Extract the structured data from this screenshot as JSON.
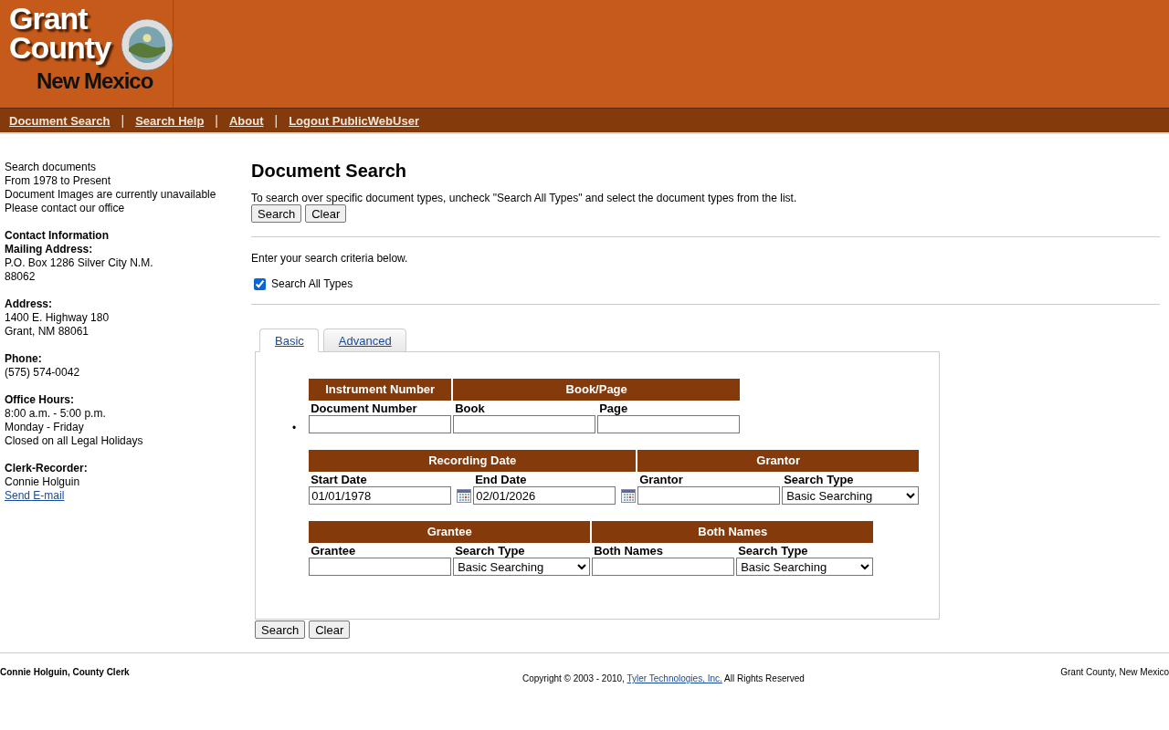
{
  "logo": {
    "lines": [
      "Grant",
      "County",
      "New Mexico"
    ]
  },
  "nav": [
    "Document Search",
    "Search Help",
    "About",
    "Logout PublicWebUser"
  ],
  "nav_separator": "|",
  "sidebar": [
    {
      "lines": [
        {
          "kind": "text",
          "text": "Search documents"
        },
        {
          "kind": "text",
          "text": "From 1978 to Present"
        },
        {
          "kind": "text",
          "text": "Document Images are currently unavailable"
        },
        {
          "kind": "text",
          "text": "Please contact our office"
        }
      ]
    },
    {
      "lines": [
        {
          "kind": "heading",
          "text": "Contact Information"
        },
        {
          "kind": "heading",
          "text": "Mailing Address:"
        },
        {
          "kind": "text",
          "text": "P.O. Box 1286 Silver City N.M."
        },
        {
          "kind": "text",
          "text": "88062"
        }
      ]
    },
    {
      "lines": [
        {
          "kind": "heading",
          "text": "Address:"
        },
        {
          "kind": "text",
          "text": "1400 E. Highway 180"
        },
        {
          "kind": "text",
          "text": "Grant, NM 88061"
        }
      ]
    },
    {
      "lines": [
        {
          "kind": "heading",
          "text": "Phone:"
        },
        {
          "kind": "text",
          "text": "(575) 574-0042"
        }
      ]
    },
    {
      "lines": [
        {
          "kind": "heading",
          "text": "Office Hours:"
        },
        {
          "kind": "text",
          "text": "8:00 a.m. - 5:00 p.m."
        },
        {
          "kind": "text",
          "text": "Monday - Friday"
        },
        {
          "kind": "text",
          "text": "Closed on all Legal Holidays"
        }
      ]
    },
    {
      "lines": [
        {
          "kind": "heading",
          "text": "Clerk-Recorder:"
        },
        {
          "kind": "text",
          "text": "Connie Holguin"
        },
        {
          "kind": "link",
          "text": "Send E-mail"
        }
      ]
    }
  ],
  "title": "Document Search",
  "instructions": "To search over specific document types, uncheck \"Search All Types\" and select the document types from the list.",
  "top_buttons": [
    "Search",
    "Clear"
  ],
  "criteria_text": "Enter your search criteria below.",
  "search_all_types": {
    "label": "Search All Types",
    "checked": true
  },
  "tabs": [
    {
      "label": "Basic",
      "selected": true
    },
    {
      "label": "Advanced",
      "selected": false
    }
  ],
  "bullet": "•",
  "sections": [
    {
      "groups": [
        {
          "header": "Instrument Number",
          "fields": [
            {
              "kind": "text",
              "label": "Document Number"
            }
          ]
        },
        {
          "header": "Book/Page",
          "fields": [
            {
              "kind": "text",
              "label": "Book"
            },
            {
              "kind": "text",
              "label": "Page"
            }
          ]
        }
      ]
    },
    {
      "groups": [
        {
          "header": "Recording Date",
          "fields": [
            {
              "kind": "date",
              "label": "Start Date",
              "value": "01/01/1978"
            },
            {
              "kind": "date",
              "label": "End Date",
              "value": "02/01/2026"
            }
          ]
        },
        {
          "header": "Grantor",
          "fields": [
            {
              "kind": "text",
              "label": "Grantor"
            },
            {
              "kind": "select",
              "label": "Search Type",
              "value": "Basic Searching"
            }
          ]
        }
      ]
    },
    {
      "groups": [
        {
          "header": "Grantee",
          "fields": [
            {
              "kind": "text",
              "label": "Grantee"
            },
            {
              "kind": "select",
              "label": "Search Type",
              "value": "Basic Searching"
            }
          ]
        },
        {
          "header": "Both Names",
          "fields": [
            {
              "kind": "text",
              "label": "Both Names"
            },
            {
              "kind": "select",
              "label": "Search Type",
              "value": "Basic Searching"
            }
          ]
        }
      ]
    }
  ],
  "bottom_buttons": [
    "Search",
    "Clear"
  ],
  "footer": {
    "left": "Connie Holguin, County Clerk",
    "copyright": "Copyright © 2003 - 2010,",
    "company_link": "Tyler Technologies, Inc.",
    "rights": "All Rights Reserved",
    "right": "Grant County, New Mexico"
  }
}
